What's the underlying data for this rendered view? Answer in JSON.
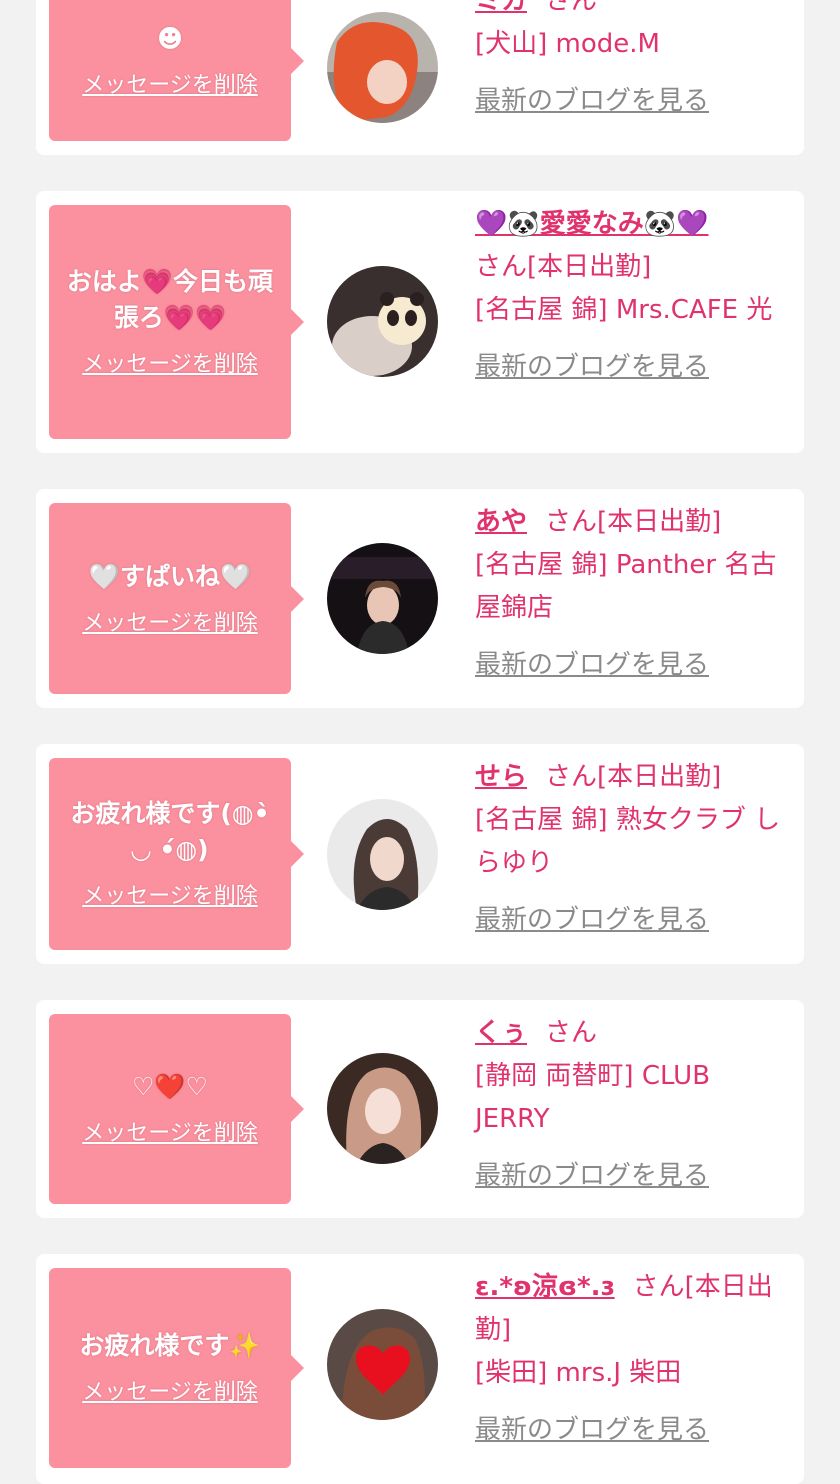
{
  "delete_label": "メッセージを削除",
  "blog_label": "最新のブログを見る",
  "san_label": "さん",
  "cards": [
    {
      "message": "☻",
      "name": "ミカ",
      "suffix": "さん",
      "shop": "[犬山] mode.M"
    },
    {
      "message": "おはよ💗今日も頑張ろ💗💗",
      "name": "💜🐼愛愛なみ🐼💜",
      "suffix": "さん[本日出勤]",
      "shop": "[名古屋 錦] Mrs.CAFE 光"
    },
    {
      "message": "🤍すぱいね🤍",
      "name": "あや",
      "suffix": "さん[本日出勤]",
      "shop": "[名古屋 錦] Panther 名古屋錦店"
    },
    {
      "message": "お疲れ様です(◍•̀ ◡ •́◍)",
      "name": "せら",
      "suffix": "さん[本日出勤]",
      "shop": "[名古屋 錦] 熟女クラブ しらゆり"
    },
    {
      "message": "♡❤️♡",
      "name": "くぅ",
      "suffix": "さん",
      "shop": "[静岡 両替町] CLUB JERRY"
    },
    {
      "message": "お疲れ様です✨",
      "name": "ε.*ʚ涼ɞ*.ɜ",
      "suffix": "さん[本日出勤]",
      "shop": "[柴田] mrs.J 柴田"
    }
  ],
  "colors": {
    "bubble": "#fb919f",
    "accent": "#e0336e",
    "muted": "#8a8a8a",
    "background": "#f2f2f2"
  }
}
